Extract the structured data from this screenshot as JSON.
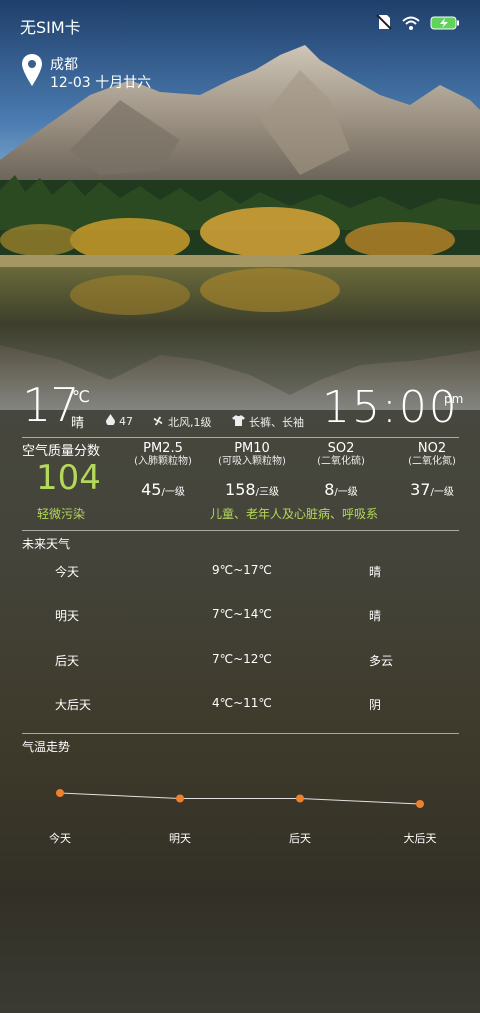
{
  "status_bar": {
    "carrier": "无SIM卡",
    "icons": [
      "no-sim-icon",
      "wifi-icon",
      "battery-charging-icon"
    ]
  },
  "location": {
    "city": "成都",
    "date": "12-03 十月廿六"
  },
  "current": {
    "temperature": "17",
    "unit": "℃",
    "condition": "晴",
    "humidity": "47",
    "wind": "北风,1级",
    "clothing": "长裤、长袖",
    "time": "15:00",
    "ampm": "pm"
  },
  "aqi": {
    "title": "空气质量分数",
    "value": "104",
    "level": "轻微污染",
    "advice": "儿童、老年人及心脏病、呼吸系",
    "pollutants": [
      {
        "name": "PM2.5",
        "sub": "(入肺颗粒物)",
        "value": "45",
        "unit": "/一级"
      },
      {
        "name": "PM10",
        "sub": "(可吸入颗粒物)",
        "value": "158",
        "unit": "/三级"
      },
      {
        "name": "SO2",
        "sub": "(二氧化硫)",
        "value": "8",
        "unit": "/一级"
      },
      {
        "name": "NO2",
        "sub": "(二氧化氮)",
        "value": "37",
        "unit": "/一级"
      }
    ]
  },
  "forecast": {
    "title": "未来天气",
    "days": [
      {
        "day": "今天",
        "temp": "9℃~17℃",
        "cond": "晴"
      },
      {
        "day": "明天",
        "temp": "7℃~14℃",
        "cond": "晴"
      },
      {
        "day": "后天",
        "temp": "7℃~12℃",
        "cond": "多云"
      },
      {
        "day": "大后天",
        "temp": "4℃~11℃",
        "cond": "阴"
      }
    ]
  },
  "trend": {
    "title": "气温走势",
    "accent": "#f07f2e"
  },
  "chart_data": {
    "type": "line",
    "categories": [
      "今天",
      "明天",
      "后天",
      "大后天"
    ],
    "series": [
      {
        "values": [
          17,
          14,
          14,
          11
        ]
      }
    ],
    "title": "",
    "xlabel": "",
    "ylabel": "",
    "grid": false
  }
}
